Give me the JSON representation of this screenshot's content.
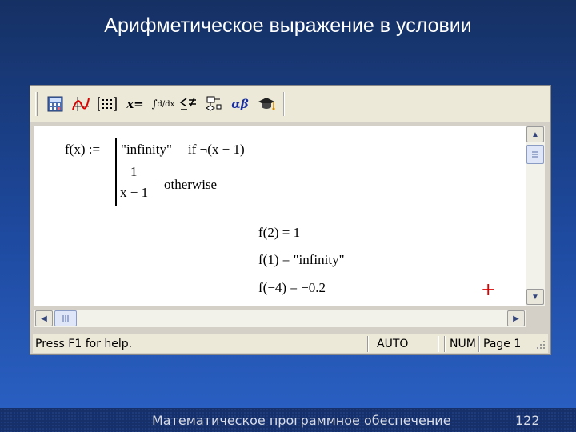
{
  "slide": {
    "title": "Арифметическое выражение в условии",
    "footer": "Математическое программное обеспечение",
    "page_number": "122"
  },
  "toolbar": {
    "buttons": [
      {
        "name": "calculator-toolbar-icon",
        "label": "▦"
      },
      {
        "name": "graph-toolbar-icon",
        "label": "𝒩"
      },
      {
        "name": "matrix-toolbar-icon",
        "label": "[:::]"
      },
      {
        "name": "evaluation-toolbar-icon",
        "label": "x="
      },
      {
        "name": "calculus-toolbar-icon",
        "label": "∫ d/dx"
      },
      {
        "name": "boolean-toolbar-icon",
        "label": "<≠"
      },
      {
        "name": "programming-toolbar-icon",
        "label": "⊡"
      },
      {
        "name": "greek-toolbar-icon",
        "label": "αβ"
      },
      {
        "name": "symbolic-toolbar-icon",
        "label": "🎓"
      }
    ]
  },
  "worksheet": {
    "definition": {
      "lhs": "f(x) :=",
      "case1_value": "\"infinity\"",
      "case1_cond": "if  ¬(x − 1)",
      "case2_num": "1",
      "case2_den": "x − 1",
      "case2_cond": "otherwise"
    },
    "results": [
      "f(2) = 1",
      "f(1) = \"infinity\"",
      "f(−4) = −0.2"
    ],
    "cursor": "+"
  },
  "statusbar": {
    "help": "Press F1 for help.",
    "mode": "AUTO",
    "num": "NUM",
    "page": "Page 1"
  },
  "colors": {
    "background": "#1e4aa0",
    "cursor": "#e00000"
  }
}
